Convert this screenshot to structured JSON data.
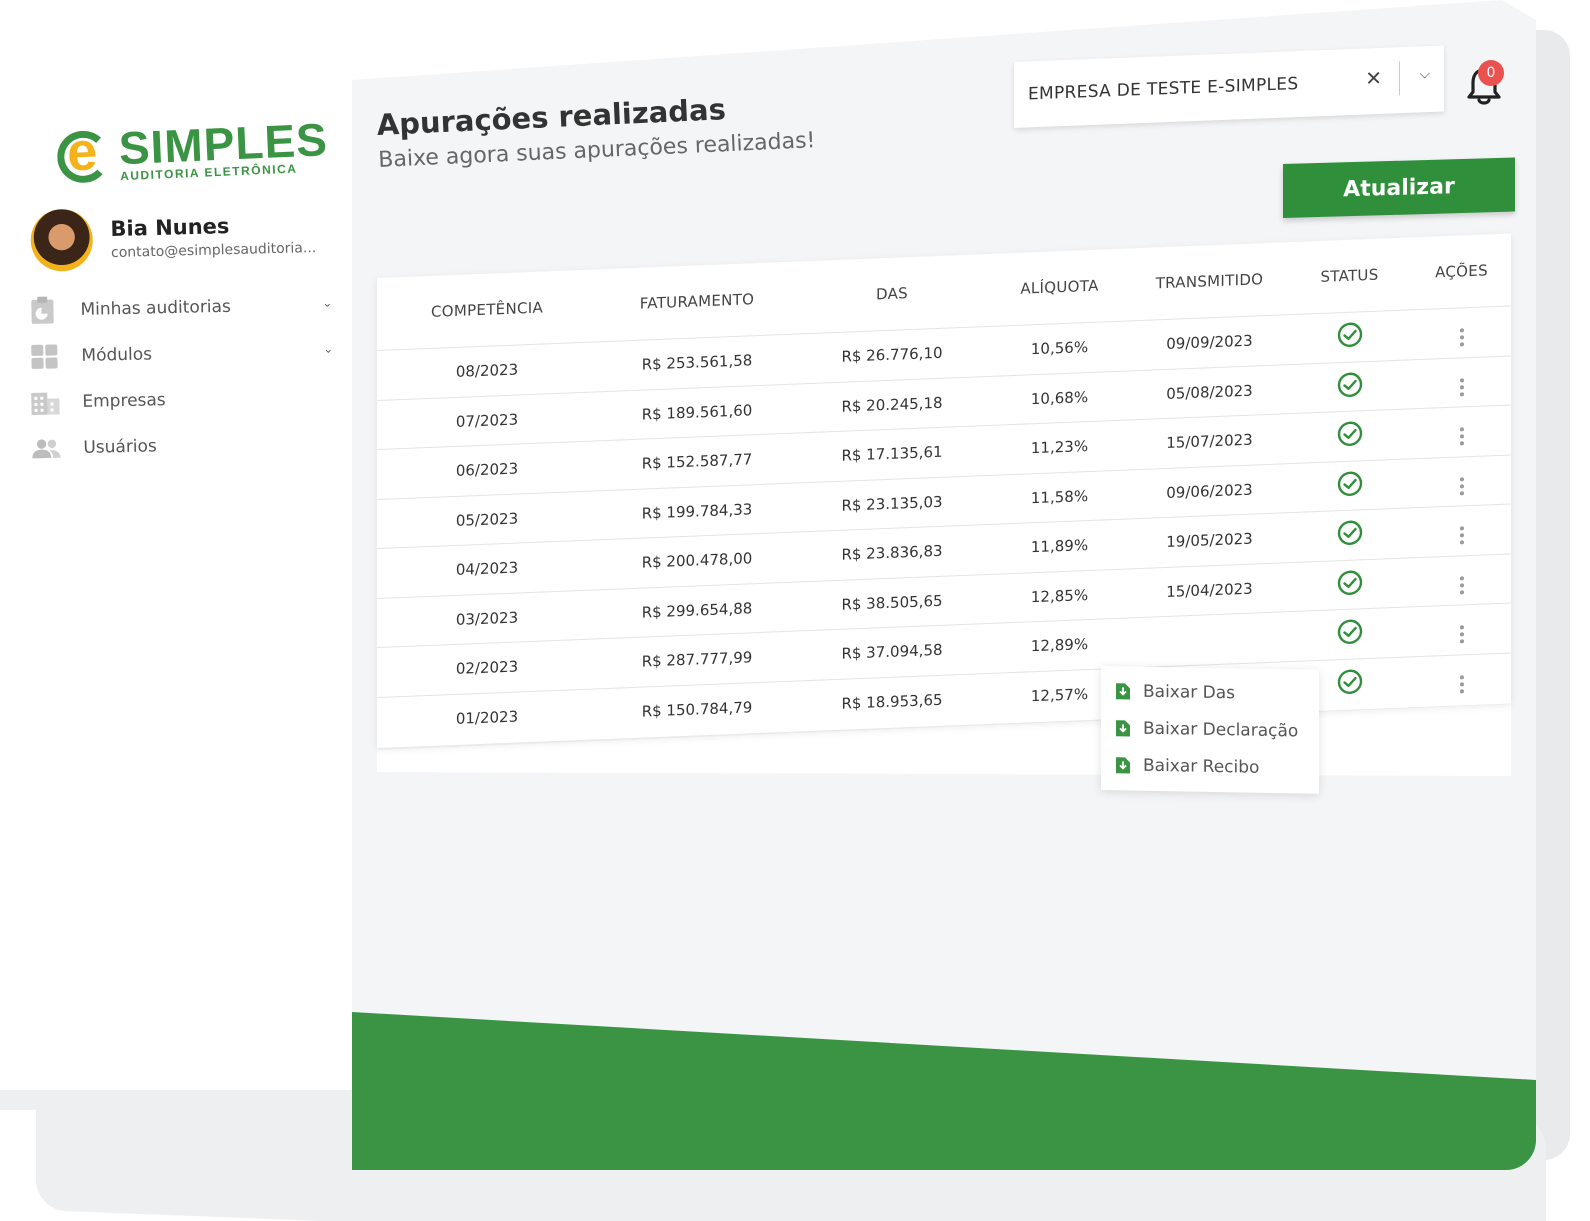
{
  "brand": {
    "logo_main": "SIMPLES",
    "logo_sub": "AUDITORIA ELETRÔNICA"
  },
  "user": {
    "name": "Bia Nunes",
    "email": "contato@esimplesauditoria..."
  },
  "sidebar": {
    "items": [
      {
        "label": "Minhas auditorias",
        "icon": "report-icon",
        "has_submenu": true
      },
      {
        "label": "Módulos",
        "icon": "modules-grid-icon",
        "has_submenu": true
      },
      {
        "label": "Empresas",
        "icon": "building-icon",
        "has_submenu": false
      },
      {
        "label": "Usuários",
        "icon": "users-icon",
        "has_submenu": false
      }
    ]
  },
  "header": {
    "title": "Apurações realizadas",
    "subtitle": "Baixe agora suas apurações realizadas!",
    "company_select": {
      "value": "EMPRESA DE TESTE E-SIMPLES"
    },
    "notifications_count": "0",
    "update_label": "Atualizar"
  },
  "table": {
    "columns": [
      "COMPETÊNCIA",
      "FATURAMENTO",
      "DAS",
      "ALÍQUOTA",
      "TRANSMITIDO",
      "STATUS",
      "AÇÕES"
    ],
    "rows": [
      {
        "competencia": "08/2023",
        "faturamento": "R$ 253.561,58",
        "das": "R$ 26.776,10",
        "aliquota": "10,56%",
        "transmitido": "09/09/2023",
        "status": "ok"
      },
      {
        "competencia": "07/2023",
        "faturamento": "R$ 189.561,60",
        "das": "R$ 20.245,18",
        "aliquota": "10,68%",
        "transmitido": "05/08/2023",
        "status": "ok"
      },
      {
        "competencia": "06/2023",
        "faturamento": "R$ 152.587,77",
        "das": "R$ 17.135,61",
        "aliquota": "11,23%",
        "transmitido": "15/07/2023",
        "status": "ok"
      },
      {
        "competencia": "05/2023",
        "faturamento": "R$ 199.784,33",
        "das": "R$ 23.135,03",
        "aliquota": "11,58%",
        "transmitido": "09/06/2023",
        "status": "ok"
      },
      {
        "competencia": "04/2023",
        "faturamento": "R$ 200.478,00",
        "das": "R$ 23.836,83",
        "aliquota": "11,89%",
        "transmitido": "19/05/2023",
        "status": "ok"
      },
      {
        "competencia": "03/2023",
        "faturamento": "R$ 299.654,88",
        "das": "R$ 38.505,65",
        "aliquota": "12,85%",
        "transmitido": "15/04/2023",
        "status": "ok"
      },
      {
        "competencia": "02/2023",
        "faturamento": "R$ 287.777,99",
        "das": "R$ 37.094,58",
        "aliquota": "12,89%",
        "transmitido": "",
        "status": "ok"
      },
      {
        "competencia": "01/2023",
        "faturamento": "R$ 150.784,79",
        "das": "R$ 18.953,65",
        "aliquota": "12,57%",
        "transmitido": "",
        "status": "ok"
      }
    ]
  },
  "action_menu": {
    "items": [
      "Baixar Das",
      "Baixar Declaração",
      "Baixar Recibo"
    ]
  },
  "colors": {
    "brand_green": "#3a9444",
    "button_green": "#2f8f3a",
    "accent_yellow": "#f6b21a",
    "badge_red": "#e9524f"
  }
}
